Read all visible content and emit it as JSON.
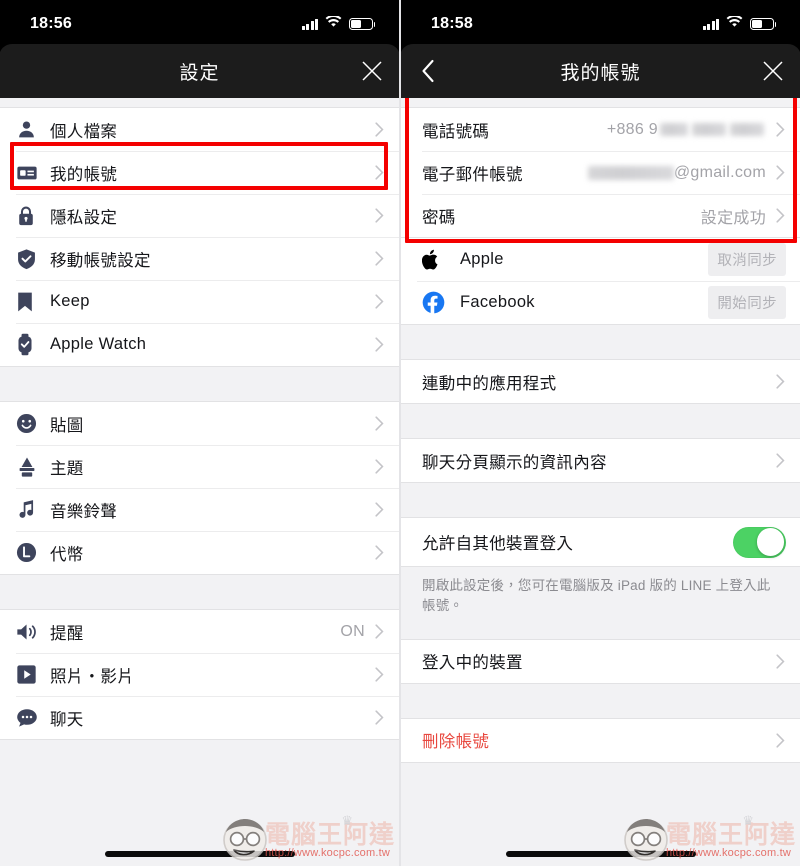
{
  "left": {
    "status": {
      "clock": "18:56",
      "signal_icon": "cellular-signal-icon",
      "wifi_icon": "wifi-icon",
      "battery_icon": "battery-icon"
    },
    "nav": {
      "title": "設定",
      "close_label": "✕",
      "close_icon": "close-icon"
    },
    "groups": [
      {
        "items": [
          {
            "icon": "person-icon",
            "label": "個人檔案",
            "value": "",
            "chevron": true
          },
          {
            "icon": "id-card-icon",
            "label": "我的帳號",
            "value": "",
            "chevron": true,
            "highlighted": true
          },
          {
            "icon": "lock-icon",
            "label": "隱私設定",
            "value": "",
            "chevron": true
          },
          {
            "icon": "shield-check-icon",
            "label": "移動帳號設定",
            "value": "",
            "chevron": true
          },
          {
            "icon": "bookmark-icon",
            "label": "Keep",
            "value": "",
            "chevron": true
          },
          {
            "icon": "watch-icon",
            "label": "Apple Watch",
            "value": "",
            "chevron": true
          }
        ]
      },
      {
        "items": [
          {
            "icon": "smiley-icon",
            "label": "貼圖",
            "value": "",
            "chevron": true
          },
          {
            "icon": "brush-icon",
            "label": "主題",
            "value": "",
            "chevron": true
          },
          {
            "icon": "music-note-icon",
            "label": "音樂鈴聲",
            "value": "",
            "chevron": true
          },
          {
            "icon": "coin-icon",
            "label": "代幣",
            "value": "",
            "chevron": true
          }
        ]
      },
      {
        "items": [
          {
            "icon": "speaker-icon",
            "label": "提醒",
            "value": "ON",
            "chevron": true
          },
          {
            "icon": "play-box-icon",
            "label": "照片・影片",
            "value": "",
            "chevron": true
          },
          {
            "icon": "chat-bubble-icon",
            "label": "聊天",
            "value": "",
            "chevron": true
          }
        ]
      }
    ]
  },
  "right": {
    "status": {
      "clock": "18:58",
      "signal_icon": "cellular-signal-icon",
      "wifi_icon": "wifi-icon",
      "battery_icon": "battery-icon"
    },
    "nav": {
      "back_icon": "back-chevron-icon",
      "title": "我的帳號",
      "close_icon": "close-icon"
    },
    "account": {
      "phone": {
        "label": "電話號碼",
        "value_prefix": "+886 9",
        "value_redacted": true
      },
      "email": {
        "label": "電子郵件帳號",
        "value_redacted": true,
        "value_suffix": "@gmail.com"
      },
      "password": {
        "label": "密碼",
        "value": "設定成功"
      }
    },
    "sync": [
      {
        "icon": "apple-logo-icon",
        "label": "Apple",
        "button": "取消同步"
      },
      {
        "icon": "facebook-logo-icon",
        "label": "Facebook",
        "button": "開始同步"
      }
    ],
    "linked_apps": {
      "label": "連動中的應用程式"
    },
    "chat_tab_info": {
      "label": "聊天分頁顯示的資訊內容"
    },
    "allow_login": {
      "label": "允許自其他裝置登入",
      "toggle_on": true,
      "note": "開啟此設定後，您可在電腦版及 iPad 版的 LINE 上登入此帳號。"
    },
    "logged_in_devices": {
      "label": "登入中的裝置"
    },
    "delete_account": {
      "label": "刪除帳號",
      "color": "#e8483f"
    }
  },
  "watermark": {
    "brand": "電腦王阿達",
    "url": "http://www.kocpc.com.tw"
  },
  "annotations": {
    "highlight_color": "#f40000",
    "boxes": [
      {
        "target": "我的帳號",
        "panel": "left"
      },
      {
        "target": "電話號碼 / 電子郵件帳號 / 密碼",
        "panel": "right"
      }
    ]
  }
}
